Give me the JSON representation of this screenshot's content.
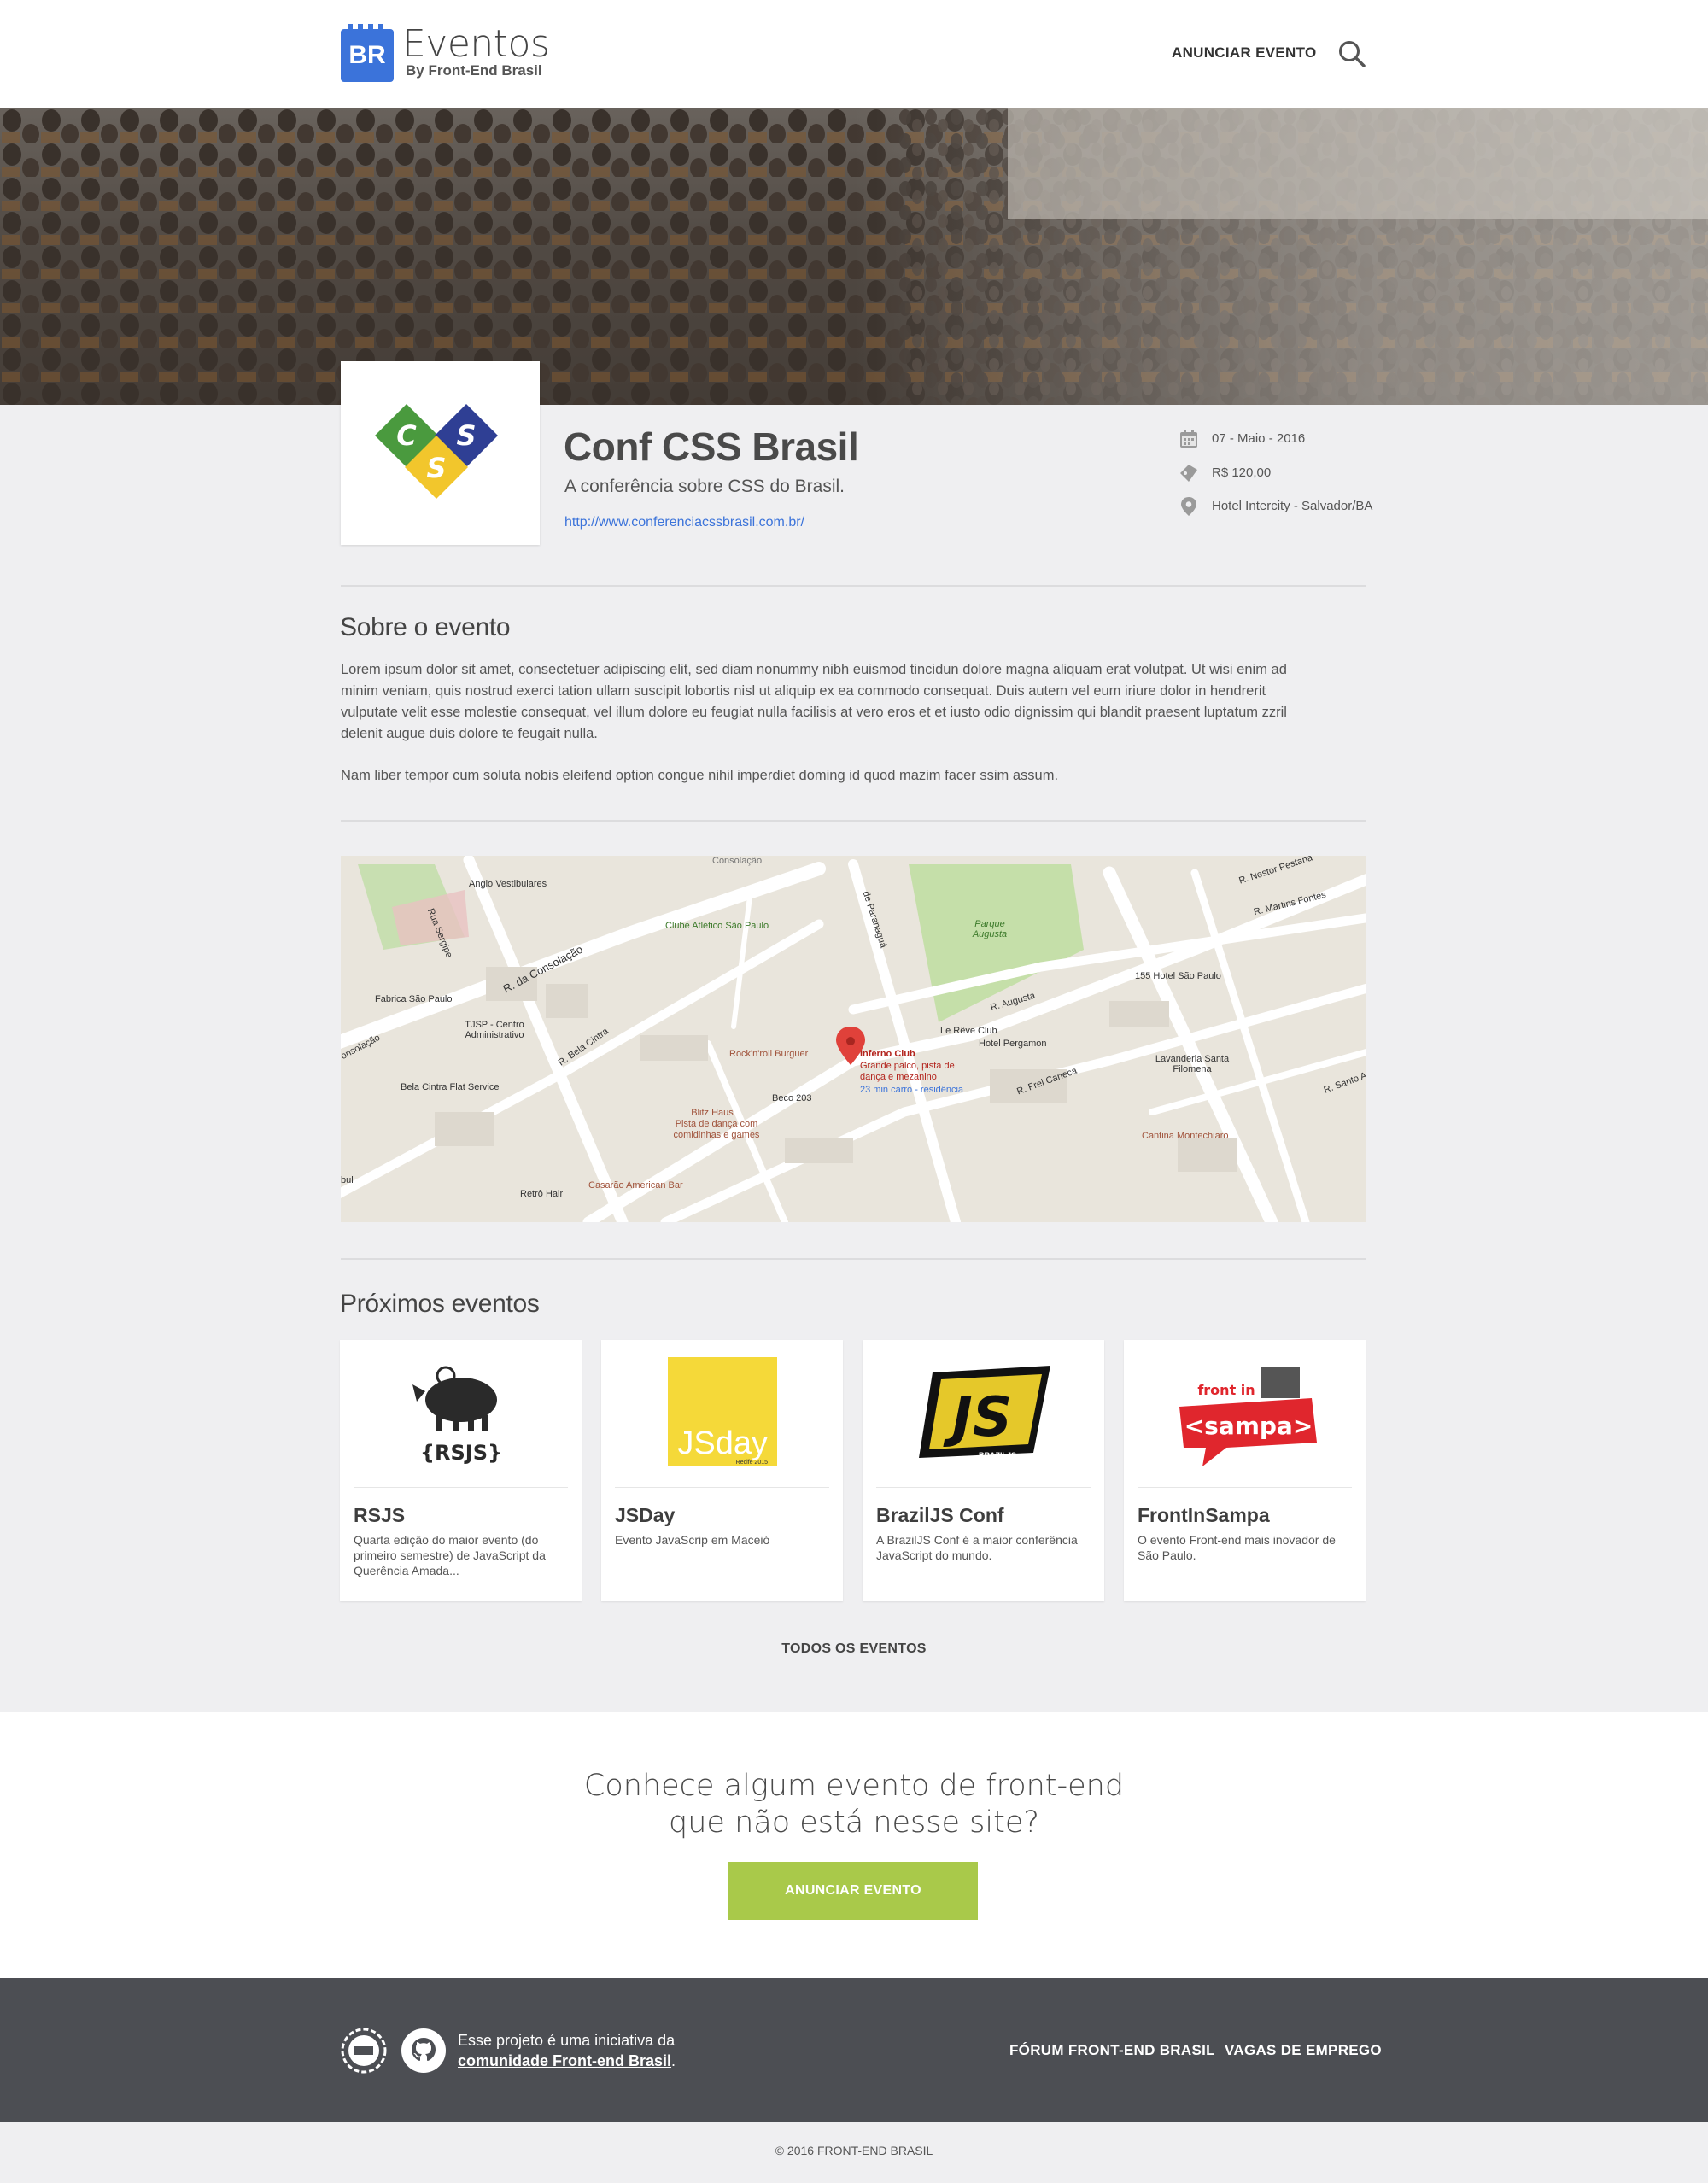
{
  "header": {
    "logo_badge": "BR",
    "logo_title": "Eventos",
    "logo_subtitle": "By Front-End Brasil",
    "nav_announce": "ANUNCIAR EVENTO"
  },
  "event": {
    "title": "Conf CSS Brasil",
    "subtitle": "A conferência sobre CSS do Brasil.",
    "url": "http://www.conferenciacssbrasil.com.br/",
    "date": "07 - Maio - 2016",
    "price": "R$ 120,00",
    "location": "Hotel Intercity - Salvador/BA",
    "logo_letters": [
      "C",
      "S",
      "S"
    ]
  },
  "about": {
    "title": "Sobre o evento",
    "p1": "Lorem ipsum dolor sit amet, consectetuer adipiscing elit, sed diam nonummy nibh euismod tincidun dolore magna aliquam erat volutpat. Ut wisi enim ad minim veniam, quis nostrud exerci tation ullam suscipit lobortis nisl ut aliquip ex ea commodo consequat. Duis autem vel eum iriure dolor in hendrerit vulputate velit esse molestie consequat, vel illum dolore eu feugiat nulla facilisis at vero eros et et iusto odio dignissim qui blandit praesent luptatum zzril delenit augue duis dolore te feugait nulla.",
    "p2": "Nam liber tempor cum soluta nobis eleifend option congue nihil imperdiet doming id quod mazim facer ssim assum."
  },
  "map": {
    "labels": {
      "anglo": "Anglo Vestibulares",
      "consolacao_top": "Consolação",
      "rua_sergipe": "Rua Sergipe",
      "r_consolacao": "R. da Consolação",
      "clube": "Clube Atlético São Paulo",
      "paranagua": "de Paranaguá",
      "parque": "Parque Augusta",
      "nestor": "R. Nestor Pestana",
      "martins": "R. Martins Fontes",
      "fabrica": "Fabrica São Paulo",
      "tjsp": "TJSP - Centro Administrativo",
      "consolacao_left": "onsolação",
      "bela_cintra": "R. Bela Cintra",
      "augusta": "R. Augusta",
      "hotel155": "155 Hotel São Paulo",
      "reve": "Le Rêve Club",
      "pergamon": "Hotel Pergamon",
      "rocknroll": "Rock'n'roll Burguer",
      "inferno": "Inferno Club",
      "inferno_desc": "Grande palco, pista de dança e mezanino",
      "inferno_time": "23 min carro - residência",
      "frei_caneca": "R. Frei Caneca",
      "lavanderia": "Lavanderia Santa Filomena",
      "bela_flat": "Bela Cintra Flat Service",
      "blitz": "Blitz Haus",
      "blitz_desc": "Pista de dança com comidinhas e games",
      "beco": "Beco 203",
      "cantina": "Cantina Montechiaro",
      "casarao": "Casarão American Bar",
      "retro": "Retrô Hair",
      "santo": "R. Santo A",
      "bul": "bul"
    }
  },
  "next_events": {
    "title": "Próximos eventos",
    "items": [
      {
        "name": "RSJS",
        "desc": "Quarta edição do maior evento (do primeiro semestre) de JavaScript da Querência Amada...",
        "logo_text": "{RSJS}"
      },
      {
        "name": "JSDay",
        "desc": "Evento JavaScrip em Maceió",
        "logo_text": "JSday",
        "logo_small": "Recife 2015"
      },
      {
        "name": "BrazilJS Conf",
        "desc": "A BrazilJS Conf é a maior conferência JavaScript do mundo.",
        "logo_text": "JS",
        "logo_small": "BRAZILJS"
      },
      {
        "name": "FrontInSampa",
        "desc": "O evento Front-end mais inovador de São Paulo.",
        "logo_text": "<sampa>",
        "logo_small": "front in"
      }
    ],
    "all_label": "TODOS OS EVENTOS"
  },
  "cta": {
    "line1": "Conhece algum evento de front-end",
    "line2": "que não está nesse site?",
    "button": "ANUNCIAR EVENTO"
  },
  "footer": {
    "text1": "Esse projeto é uma iniciativa da",
    "text2": "comunidade Front-end Brasil",
    "text2_suffix": ".",
    "link_forum": "FÓRUM FRONT-END BRASIL",
    "link_jobs": "VAGAS DE EMPREGO",
    "copyright": "© 2016 FRONT-END BRASIL"
  },
  "colors": {
    "brand_blue": "#3b73da",
    "cta_green": "#a9c94a",
    "footer_bg": "#4c4e53"
  }
}
